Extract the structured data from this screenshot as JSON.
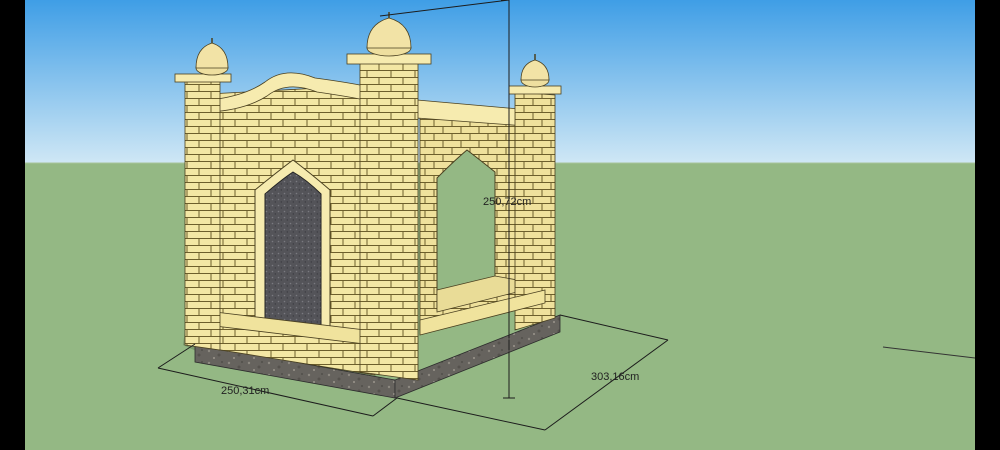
{
  "viewport": {
    "sky_top_color": "#3f9ee6",
    "sky_bottom_color": "#cfe7f5",
    "ground_color": "#94b884",
    "brick_color": "#f3e7a4",
    "mortar_color": "#6d5f2c",
    "base_color": "#6d6a64"
  },
  "dimensions": {
    "width_label": "250,31cm",
    "depth_label": "303,16cm",
    "height_label": "250,72cm"
  },
  "model": {
    "name": "mausoleum-model",
    "domes": [
      "dome-left",
      "dome-center",
      "dome-right"
    ]
  }
}
